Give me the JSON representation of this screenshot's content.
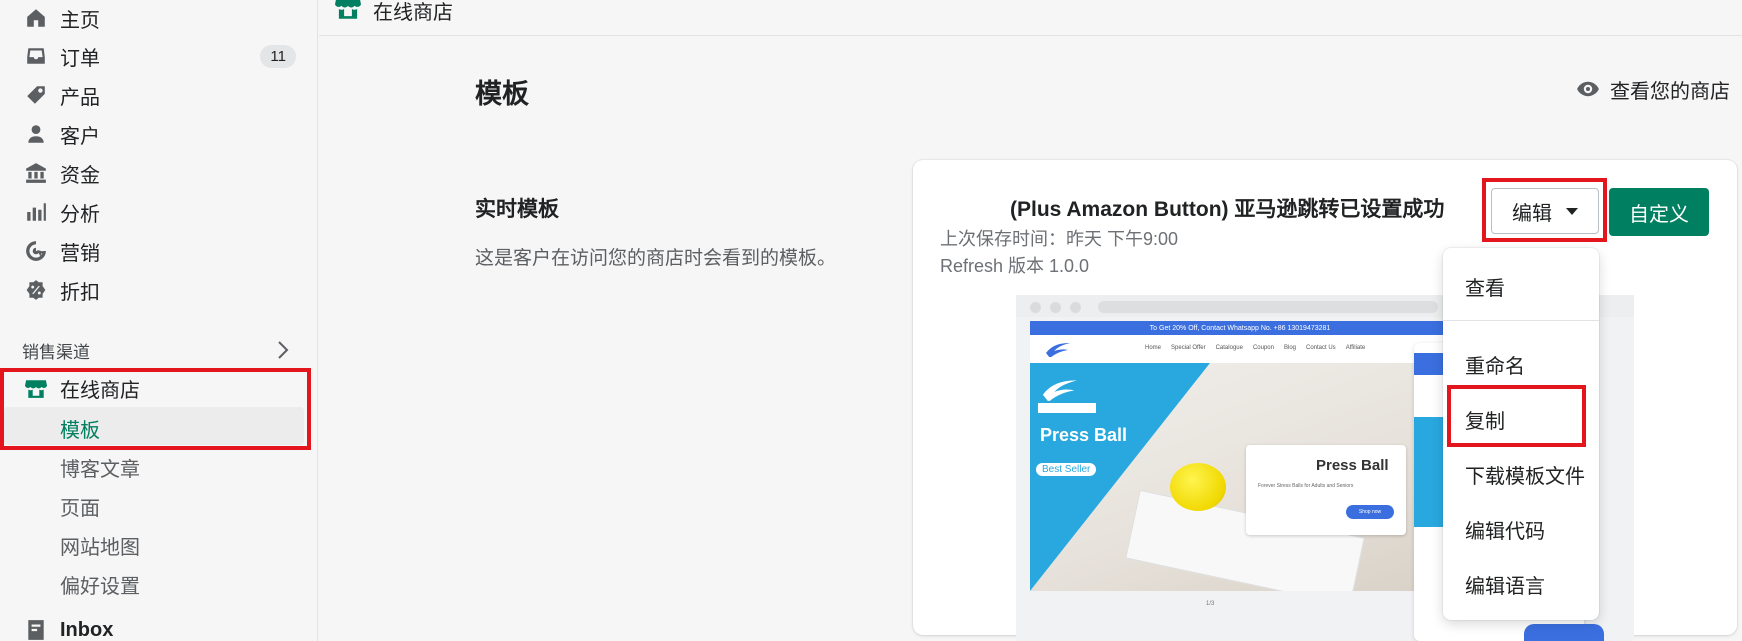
{
  "sidebar": {
    "nav": [
      {
        "label": "主页",
        "icon": "home-icon"
      },
      {
        "label": "订单",
        "icon": "inbox-tray-icon",
        "badge": "11"
      },
      {
        "label": "产品",
        "icon": "tag-icon"
      },
      {
        "label": "客户",
        "icon": "person-icon"
      },
      {
        "label": "资金",
        "icon": "bank-icon"
      },
      {
        "label": "分析",
        "icon": "bar-chart-icon"
      },
      {
        "label": "营销",
        "icon": "target-icon"
      },
      {
        "label": "折扣",
        "icon": "discount-icon"
      }
    ],
    "sales_channels_title": "销售渠道",
    "online_store": "在线商店",
    "sub_items": [
      "模板",
      "博客文章",
      "页面",
      "网站地图",
      "偏好设置"
    ],
    "inbox": "Inbox"
  },
  "topbar": {
    "title": "在线商店"
  },
  "main": {
    "page_title": "模板",
    "view_store": "查看您的商店",
    "section_heading": "实时模板",
    "section_desc": "这是客户在访问您的商店时会看到的模板。",
    "theme": {
      "name": "(Plus Amazon Button) 亚马逊跳转已设置成功",
      "saved": "上次保存时间：昨天 下午9:00",
      "version": "Refresh 版本 1.0.0"
    },
    "edit_button": "编辑",
    "customize_button": "自定义",
    "preview": {
      "promo": "To Get 20% Off, Contact Whatsapp No. +86 13019473281",
      "links": [
        "Home",
        "Special Offer",
        "Catalogue",
        "Coupon",
        "Blog",
        "Contact Us",
        "Affiliate"
      ],
      "hero_title": "Press Ball",
      "hero_badge": "Best Seller",
      "card_title": "Press Ball",
      "card_sub": "Forever Stress Balls for Adults and Seniors",
      "card_button": "Shop now",
      "pager": "1/3"
    }
  },
  "dropdown": {
    "items": [
      "查看",
      "重命名",
      "复制",
      "下载模板文件",
      "编辑代码",
      "编辑语言"
    ]
  },
  "colors": {
    "accent": "#008060",
    "highlight": "#e3161e"
  }
}
